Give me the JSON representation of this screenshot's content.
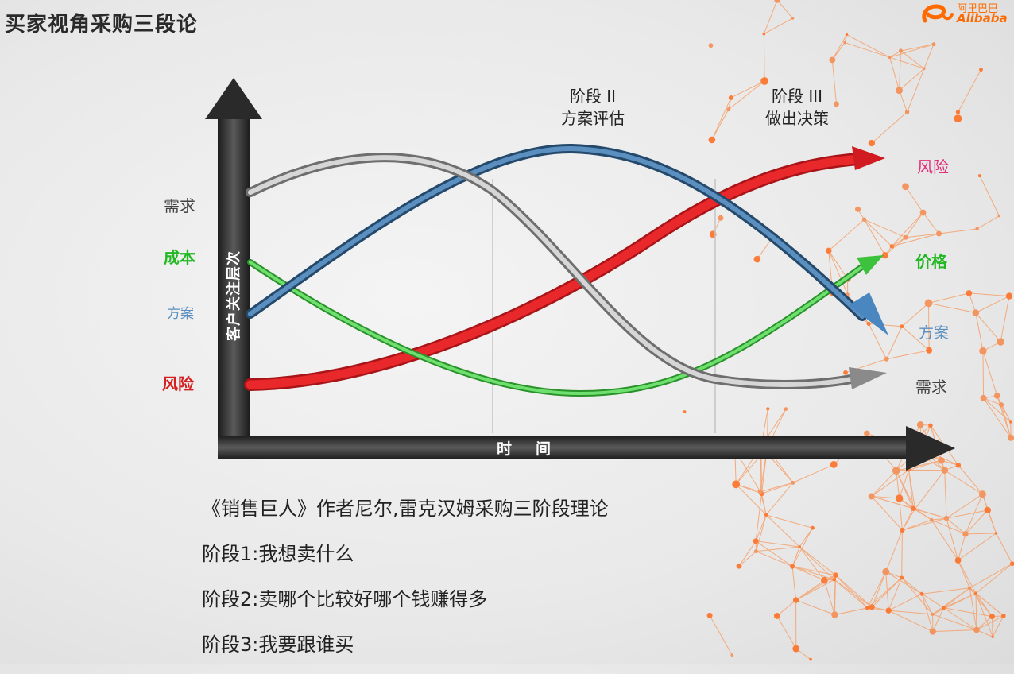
{
  "title": "买家视角采购三段论",
  "logo": {
    "cn_text": "阿里巴巴",
    "en_text": "Alibaba",
    "color": "#ff6a00"
  },
  "chart": {
    "y_axis_label": "客户关注层次",
    "x_axis_label": "时间",
    "stage2_title": "阶段 II",
    "stage2_subtitle": "方案评估",
    "stage3_title": "阶段 III",
    "stage3_subtitle": "做出决策",
    "left_labels": [
      {
        "text": "需求",
        "color": "#444444"
      },
      {
        "text": "成本",
        "color": "#22b822"
      },
      {
        "text": "方案",
        "color": "#5a8fbf"
      },
      {
        "text": "风险",
        "color": "#d42020"
      }
    ],
    "right_labels": [
      {
        "text": "风险",
        "color": "#e0307a"
      },
      {
        "text": "价格",
        "color": "#22b822"
      },
      {
        "text": "方案",
        "color": "#5a8fbf"
      },
      {
        "text": "需求",
        "color": "#444444"
      }
    ],
    "curves": [
      {
        "id": "demand",
        "color": "#b8b8b8",
        "dark": "#808080"
      },
      {
        "id": "solution",
        "color": "#3d6f9a",
        "dark": "#24496b"
      },
      {
        "id": "cost-price",
        "color": "#4cd24c",
        "dark": "#2a922a"
      },
      {
        "id": "risk",
        "color": "#e8282a",
        "dark": "#a81418"
      }
    ]
  },
  "notes": {
    "line1": "《销售巨人》作者尼尔,雷克汉姆采购三阶段理论",
    "line2": "阶段1:我想卖什么",
    "line3": "阶段2:卖哪个比较好哪个钱赚得多",
    "line4": "阶段3:我要跟谁买"
  }
}
